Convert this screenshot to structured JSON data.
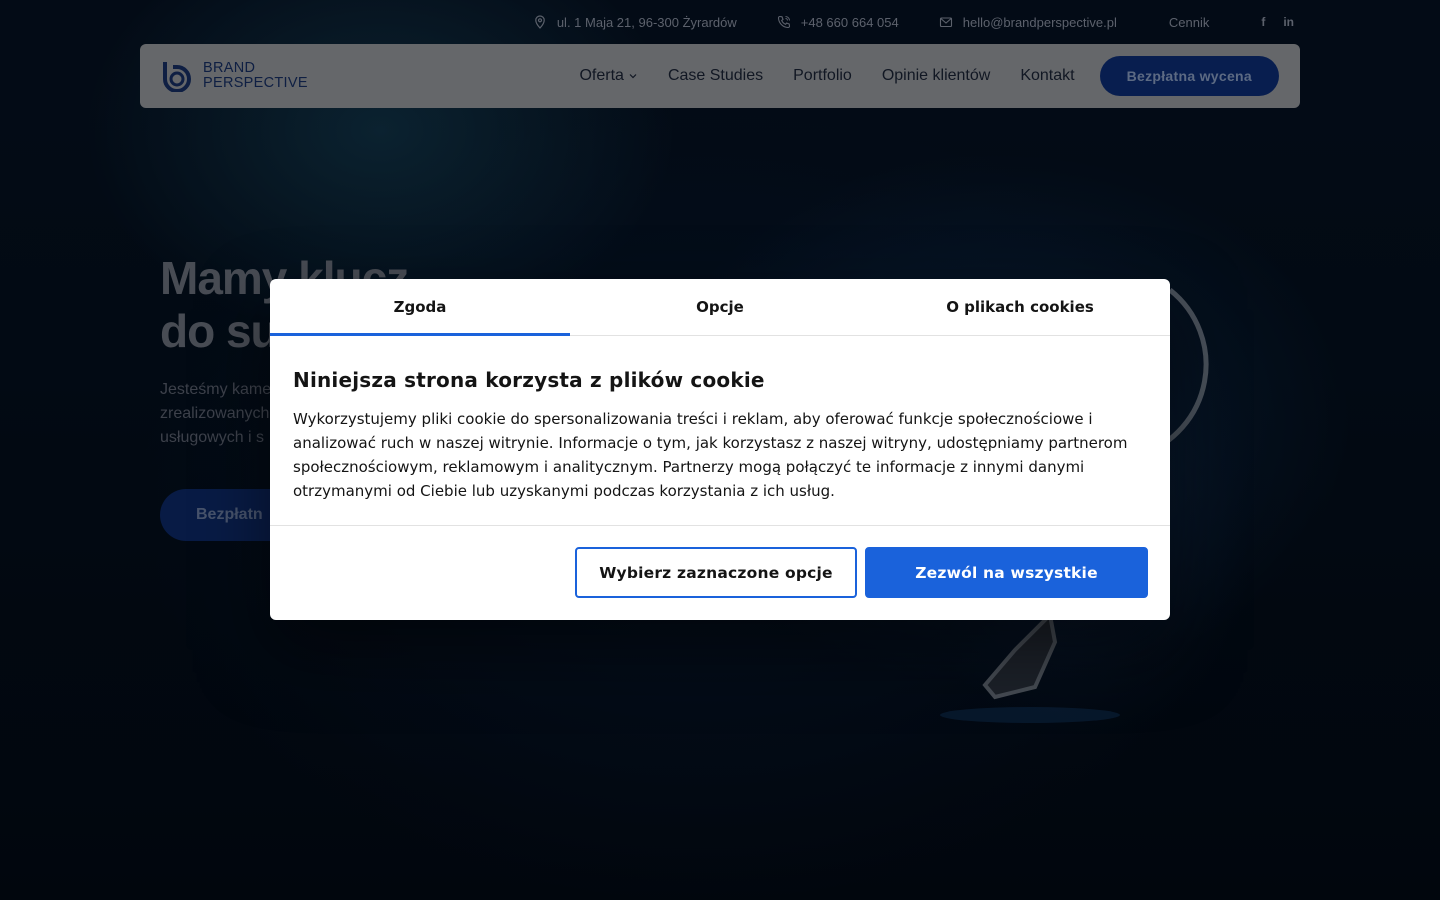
{
  "topbar": {
    "address": "ul. 1 Maja 21, 96-300 Żyrardów",
    "phone": "+48 660 664 054",
    "email": "hello@brandperspective.pl",
    "pricing": "Cennik",
    "social": [
      "f",
      "in"
    ]
  },
  "nav": {
    "logo_line1": "BRAND",
    "logo_line2": "PERSPECTIVE",
    "links": [
      "Oferta",
      "Case Studies",
      "Portfolio",
      "Opinie klientów",
      "Kontakt"
    ],
    "cta": "Bezpłatna wycena"
  },
  "hero": {
    "title_line1": "Mamy klucz",
    "title_line2": "do su",
    "text_line1": "Jesteśmy kame",
    "text_line2": "zrealizowanych",
    "text_line3": "usługowych i s",
    "cta": "Bezpłatn"
  },
  "cookie": {
    "tabs": [
      "Zgoda",
      "Opcje",
      "O plikach cookies"
    ],
    "active_tab": "Zgoda",
    "title": "Niniejsza strona korzysta z plików cookie",
    "text": "Wykorzystujemy pliki cookie do spersonalizowania treści i reklam, aby oferować funkcje społecznościowe i analizować ruch w naszej witrynie. Informacje o tym, jak korzystasz z naszej witryny, udostępniamy partnerom społecznościowym, reklamowym i analitycznym. Partnerzy mogą połączyć te informacje z innymi danymi otrzymanymi od Ciebie lub uzyskanymi podczas korzystania z ich usług.",
    "btn_selected": "Wybierz zaznaczone opcje",
    "btn_allow_all": "Zezwól na wszystkie"
  },
  "colors": {
    "accent": "#1a62db",
    "brand_navy": "#173168",
    "background": "#050b18"
  }
}
